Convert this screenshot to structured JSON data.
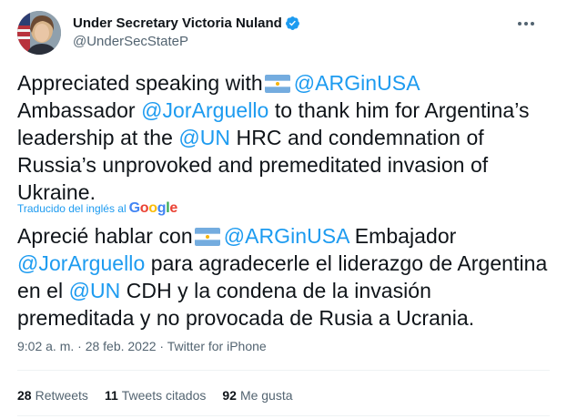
{
  "author": {
    "name": "Under Secretary Victoria Nuland",
    "handle": "@UnderSecStateP",
    "verified": true
  },
  "tweet": {
    "original": {
      "line1_pre": "Appreciated speaking with",
      "mention1": "@ARGinUSA",
      "line2_pre": "Ambassador",
      "mention2": "@JorArguello",
      "line2_post": "to thank him for Argentina’s",
      "line3_pre": "leadership at the",
      "mention3": "@UN",
      "line3_post": "HRC and condemnation of",
      "line4": "Russia’s unprovoked and premeditated invasion of",
      "line5": "Ukraine."
    },
    "translated_by": "Traducido del inglés al",
    "translation_provider": "Google",
    "translation": {
      "line1_pre": "Aprecié hablar con",
      "mention1": "@ARGinUSA",
      "line1_post": "Embajador",
      "mention2": "@JorArguello",
      "line2_post": "para agradecerle el liderazgo de Argentina",
      "line3_pre": "en el",
      "mention3": "@UN",
      "line3_post": "CDH y la condena de la invasión",
      "line4": "premeditada y no provocada de Rusia a Ucrania."
    },
    "timestamp": "9:02 a. m. · 28 feb. 2022 ·",
    "source": "Twitter for iPhone"
  },
  "stats": {
    "retweets_count": "28",
    "retweets_label": "Retweets",
    "quotes_count": "11",
    "quotes_label": "Tweets citados",
    "likes_count": "92",
    "likes_label": "Me gusta"
  },
  "colors": {
    "link": "#1d9bf0",
    "text": "#0f1419",
    "secondary": "#536471",
    "flag_blue": "#74acdf",
    "sun": "#f6b40e"
  },
  "icons": [
    "verified-badge-icon",
    "more-options-icon",
    "argentina-flag-icon"
  ]
}
